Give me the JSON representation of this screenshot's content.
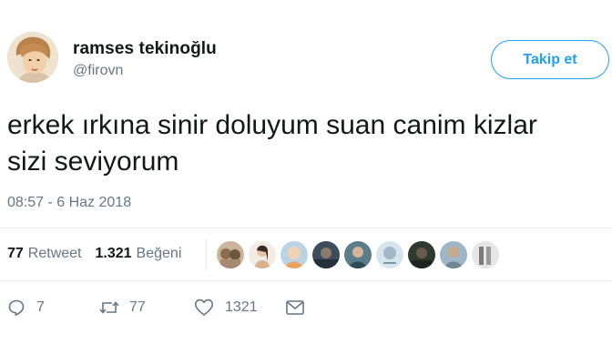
{
  "user": {
    "name": "ramses tekinoğlu",
    "handle": "@firovn"
  },
  "follow_button": {
    "label": "Takip et"
  },
  "tweet": {
    "text_lines": [
      "erkek ırkına sinir doluyum suan canim kizlar",
      "sizi seviyorum"
    ],
    "timestamp": "08:57 - 6 Haz 2018"
  },
  "stats": {
    "retweet_count": "77",
    "retweet_label": "Retweet",
    "like_count": "1.321",
    "like_label": "Beğeni"
  },
  "actions": {
    "reply_count": "7",
    "retweet_count": "77",
    "like_count": "1321"
  },
  "colors": {
    "accent": "#1da1f2",
    "secondary_text": "#657786",
    "primary_text": "#14171a"
  }
}
